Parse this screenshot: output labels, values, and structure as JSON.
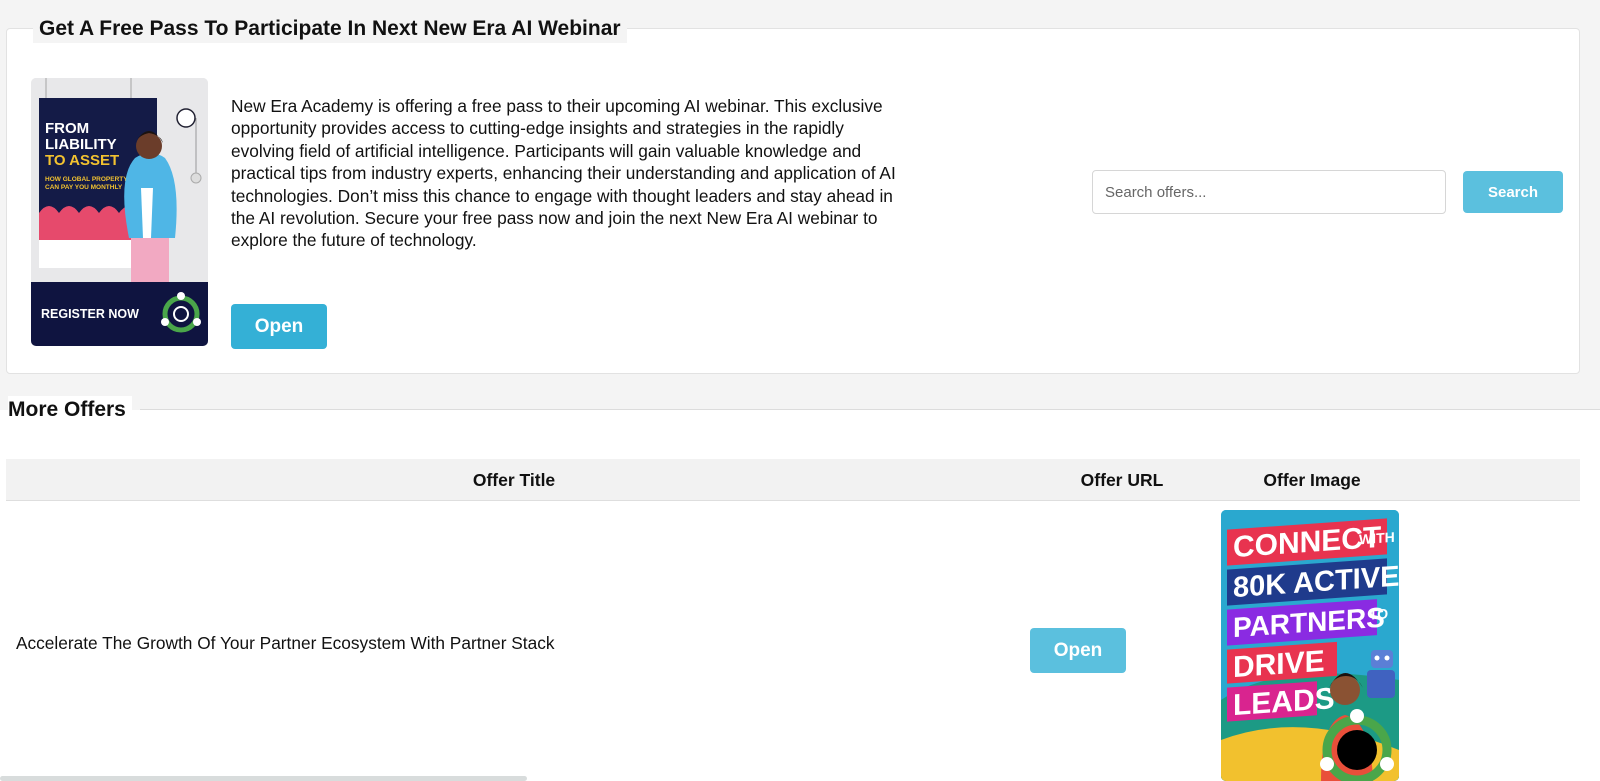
{
  "featured": {
    "title": "Get A Free Pass To Participate In Next New Era AI Webinar",
    "description": "New Era Academy is offering a free pass to their upcoming AI webinar. This exclusive opportunity provides access to cutting-edge insights and strategies in the rapidly evolving field of artificial intelligence. Participants will gain valuable knowledge and practical tips from industry experts, enhancing their understanding and application of AI technologies. Don’t miss this chance to engage with thought leaders and stay ahead in the AI revolution. Secure your free pass now and join the next New Era AI webinar to explore the future of technology.",
    "open_label": "Open",
    "poster": {
      "headline_1": "FROM",
      "headline_2": "LIABILITY",
      "headline_3": "TO ASSET",
      "sub_1": "HOW GLOBAL PROPERTY",
      "sub_2": "CAN PAY YOU MONTHLY",
      "cta": "REGISTER NOW"
    }
  },
  "search": {
    "placeholder": "Search offers...",
    "button_label": "Search"
  },
  "more_offers": {
    "title": "More Offers",
    "columns": {
      "title": "Offer Title",
      "url": "Offer URL",
      "image": "Offer Image"
    },
    "rows": [
      {
        "title": "Accelerate The Growth Of Your Partner Ecosystem With Partner Stack",
        "open_label": "Open",
        "image_lines": [
          "CONNECT",
          "WITH",
          "80K ACTIVE",
          "PARTNERS",
          "TO",
          "DRIVE",
          "LEADS"
        ]
      }
    ]
  },
  "colors": {
    "primary_button": "#34b0d6",
    "secondary_button": "#5bc0de",
    "page_background": "#f4f4f4"
  }
}
